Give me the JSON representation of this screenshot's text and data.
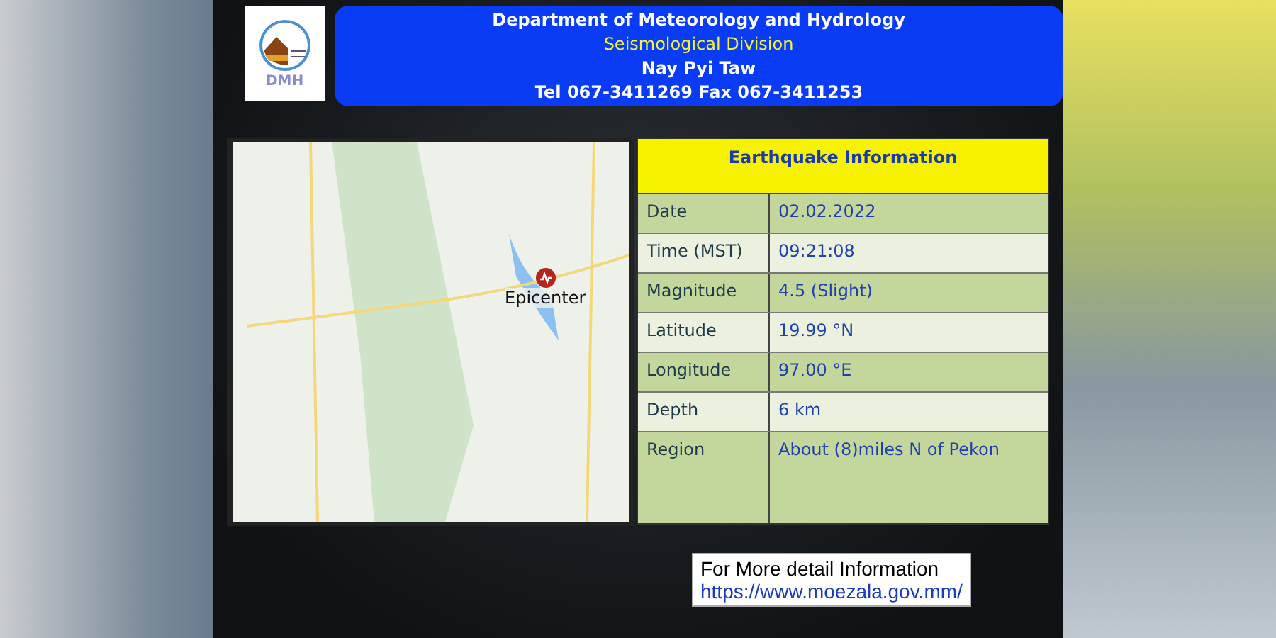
{
  "header": {
    "logo_text": "DMH",
    "lines": [
      {
        "text": "Department of Meteorology and Hydrology",
        "kind": "plain"
      },
      {
        "text": "Seismological Division",
        "kind": "highlight"
      },
      {
        "text": "Nay Pyi Taw",
        "kind": "plain"
      },
      {
        "text": "Tel 067-3411269 Fax 067-3411253",
        "kind": "plain"
      }
    ]
  },
  "map": {
    "marker_label": "Epicenter"
  },
  "info_table": {
    "title": "Earthquake Information",
    "rows": [
      {
        "label": "Date",
        "value": "02.02.2022"
      },
      {
        "label": "Time (MST)",
        "value": "09:21:08"
      },
      {
        "label": "Magnitude",
        "value": "4.5 (Slight)"
      },
      {
        "label": "Latitude",
        "value": "19.99 °N"
      },
      {
        "label": "Longitude",
        "value": "97.00 °E"
      },
      {
        "label": "Depth",
        "value": "6 km"
      },
      {
        "label": "Region",
        "value": "About (8)miles N of Pekon"
      }
    ]
  },
  "more_info": {
    "text": "For More detail Information",
    "link": "https://www.moezala.gov.mm/"
  }
}
